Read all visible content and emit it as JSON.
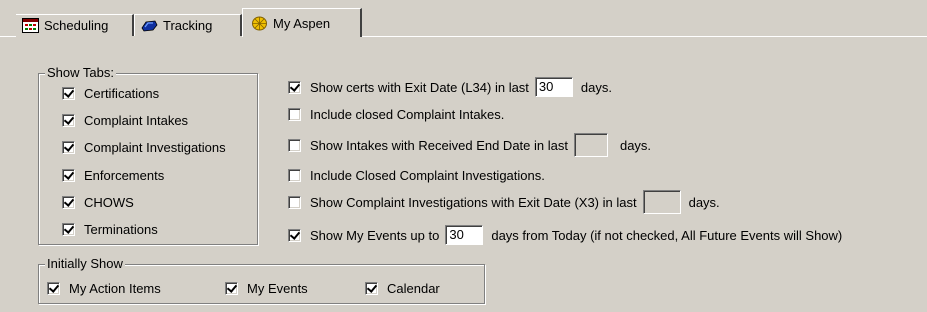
{
  "tabs": [
    {
      "label": "Scheduling",
      "icon": "scheduling-icon"
    },
    {
      "label": "Tracking",
      "icon": "tracking-icon"
    },
    {
      "label": "My Aspen",
      "icon": "aspen-leaf-icon",
      "active": true
    }
  ],
  "show_tabs": {
    "title": "Show Tabs:",
    "items": [
      {
        "label": "Certifications",
        "checked": true
      },
      {
        "label": "Complaint Intakes",
        "checked": true
      },
      {
        "label": "Complaint Investigations",
        "checked": true
      },
      {
        "label": "Enforcements",
        "checked": true
      },
      {
        "label": "CHOWS",
        "checked": true
      },
      {
        "label": "Terminations",
        "checked": true
      }
    ]
  },
  "options": [
    {
      "label": "Show certs with Exit Date (L34)  in last",
      "checked": true,
      "value": "30",
      "suffix": "days."
    },
    {
      "label": "Include closed Complaint Intakes.",
      "checked": false
    },
    {
      "label": "Show Intakes with Received End Date in last",
      "checked": false,
      "value": "",
      "suffix": "days."
    },
    {
      "label": "Include Closed Complaint Investigations.",
      "checked": false
    },
    {
      "label": "Show Complaint Investigations with Exit Date (X3) in last",
      "checked": false,
      "value": "",
      "suffix": "days."
    },
    {
      "label": "Show My Events up to",
      "checked": true,
      "value": "30",
      "suffix": "days from Today (if not checked, All Future Events will Show)"
    }
  ],
  "initially_show": {
    "title": "Initially Show",
    "items": [
      {
        "label": "My Action Items",
        "checked": true
      },
      {
        "label": "My Events",
        "checked": true
      },
      {
        "label": "Calendar",
        "checked": true
      }
    ]
  },
  "colors": {
    "background": "#d4d0c8",
    "field": "#ffffff"
  }
}
